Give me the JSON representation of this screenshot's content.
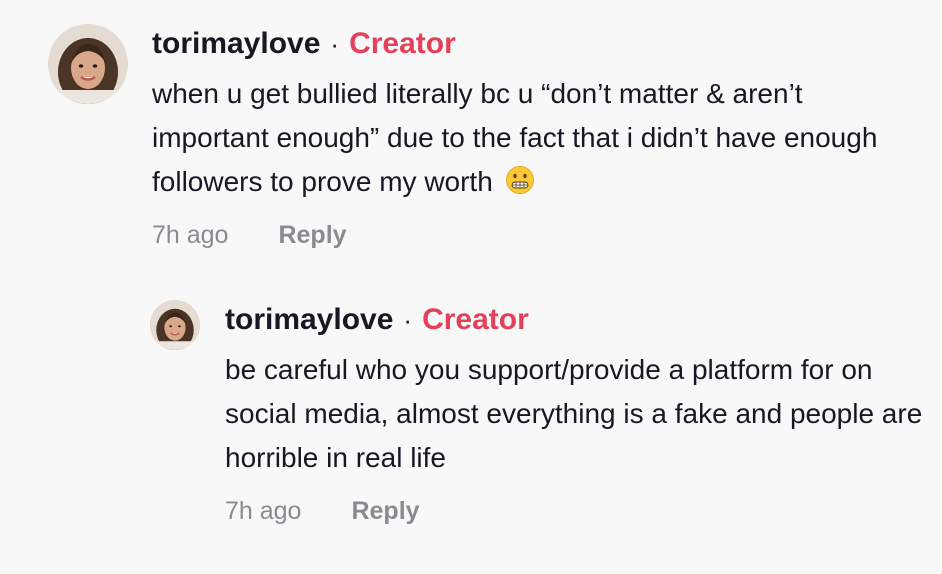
{
  "comments": [
    {
      "username": "torimaylove",
      "separator": "·",
      "badge": "Creator",
      "text": "when u get bullied literally bc u “don’t matter & aren’t important enough” due to the fact that i didn’t have enough followers to prove my worth",
      "emoji": "grimacing-face-emoji",
      "time": "7h ago",
      "reply_label": "Reply"
    },
    {
      "username": "torimaylove",
      "separator": "·",
      "badge": "Creator",
      "text": "be careful who you support/provide a platform for on social media, almost everything is a fake and people are horrible in real life",
      "time": "7h ago",
      "reply_label": "Reply"
    }
  ],
  "colors": {
    "background": "#f8f8f8",
    "text": "#161823",
    "creator_badge": "#e5405a",
    "meta": "#8a8b91"
  }
}
